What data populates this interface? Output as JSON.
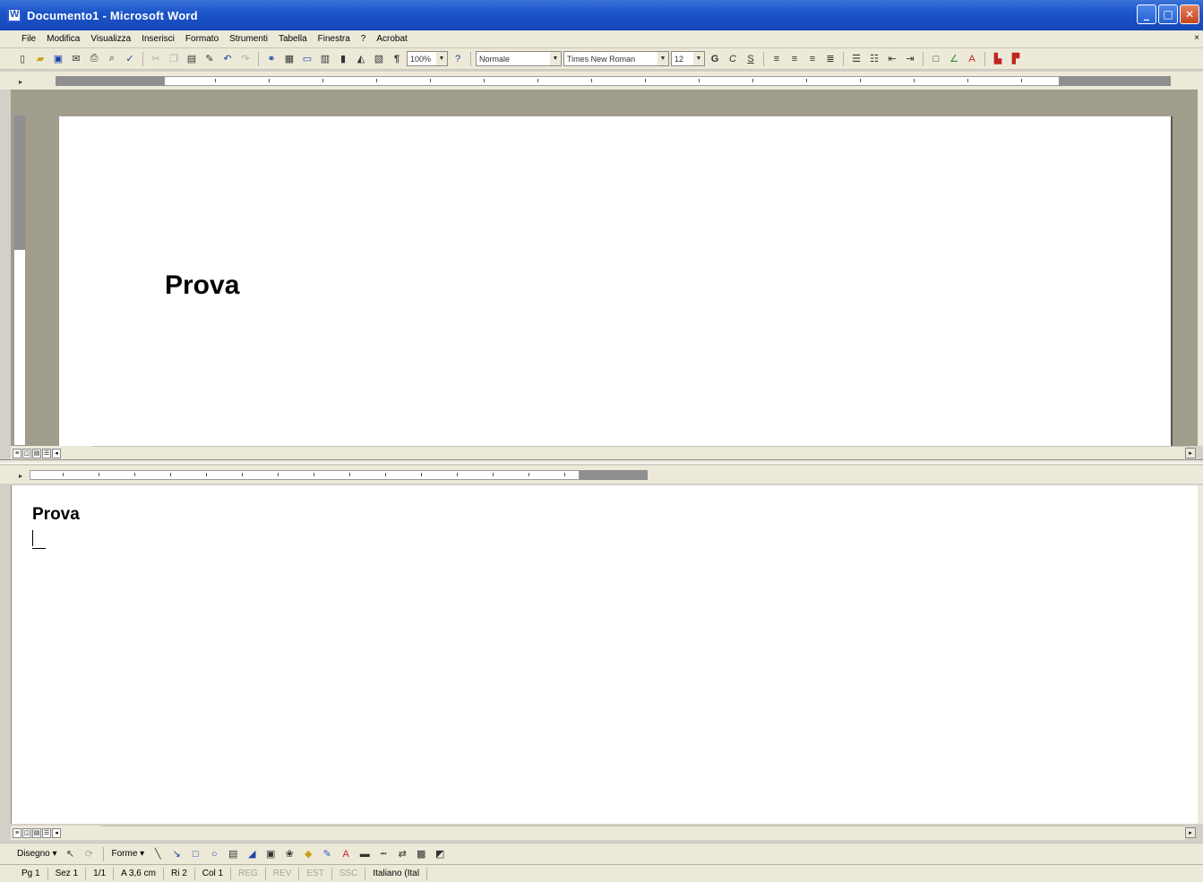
{
  "window": {
    "title": "Documento1 - Microsoft Word",
    "minimize_glyph": "_",
    "maximize_glyph": "□",
    "close_glyph": "✕"
  },
  "menu": [
    "File",
    "Modifica",
    "Visualizza",
    "Inserisci",
    "Formato",
    "Strumenti",
    "Tabella",
    "Finestra",
    "?",
    "Acrobat"
  ],
  "toolbar": {
    "zoom": "100%",
    "style": "Normale",
    "font": "Times New Roman",
    "size": "12",
    "bold": "G",
    "italic": "C",
    "underline": "S"
  },
  "document": {
    "upper_text": "Prova",
    "lower_text": "Prova"
  },
  "drawing_toolbar": {
    "draw_label": "Disegno ▾",
    "autoshapes_label": "Forme ▾"
  },
  "status": {
    "page": "Pg 1",
    "section": "Sez 1",
    "pages": "1/1",
    "at": "A 3,6 cm",
    "line": "Ri 2",
    "col": "Col 1",
    "rec": "REG",
    "trk": "REV",
    "ext": "EST",
    "ovr": "SSC",
    "language": "Italiano (Ital"
  }
}
